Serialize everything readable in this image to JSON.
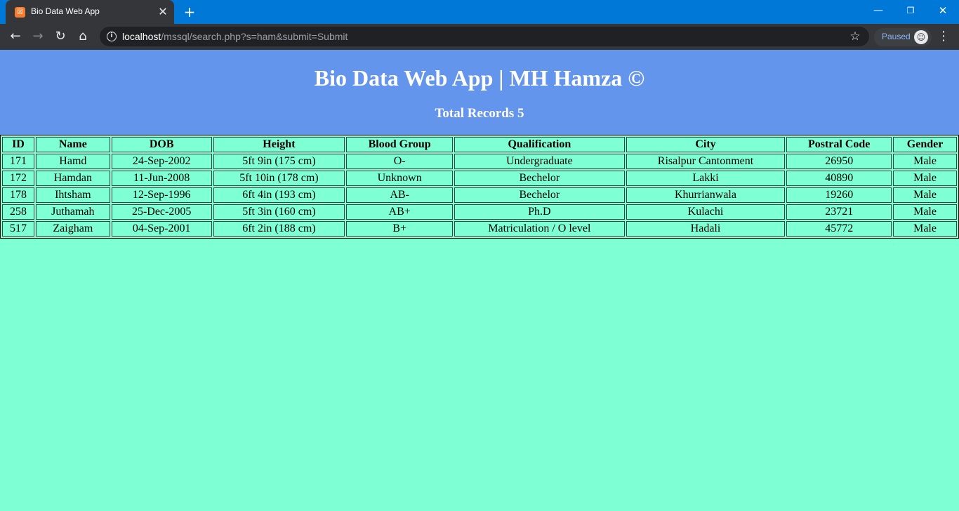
{
  "browser": {
    "tab_title": "Bio Data Web App",
    "tab_favicon": "xampp-icon",
    "url_host": "localhost",
    "url_path": "/mssql/search.php?s=ham&submit=Submit",
    "profile_status": "Paused"
  },
  "page": {
    "title": "Bio Data Web App | MH Hamza ©",
    "record_count": "Total Records 5"
  },
  "table": {
    "columns": [
      "ID",
      "Name",
      "DOB",
      "Height",
      "Blood Group",
      "Qualification",
      "City",
      "Postral Code",
      "Gender"
    ],
    "rows": [
      [
        "171",
        "Hamd",
        "24-Sep-2002",
        "5ft 9in (175 cm)",
        "O-",
        "Undergraduate",
        "Risalpur Cantonment",
        "26950",
        "Male"
      ],
      [
        "172",
        "Hamdan",
        "11-Jun-2008",
        "5ft 10in (178 cm)",
        "Unknown",
        "Bechelor",
        "Lakki",
        "40890",
        "Male"
      ],
      [
        "178",
        "Ihtsham",
        "12-Sep-1996",
        "6ft 4in (193 cm)",
        "AB-",
        "Bechelor",
        "Khurrianwala",
        "19260",
        "Male"
      ],
      [
        "258",
        "Juthamah",
        "25-Dec-2005",
        "5ft 3in (160 cm)",
        "AB+",
        "Ph.D",
        "Kulachi",
        "23721",
        "Male"
      ],
      [
        "517",
        "Zaigham",
        "04-Sep-2001",
        "6ft 2in (188 cm)",
        "B+",
        "Matriculation / O level",
        "Hadali",
        "45772",
        "Male"
      ]
    ]
  },
  "colors": {
    "titlebar": "#0078d7",
    "toolbar": "#35363a",
    "header_bg": "#6495ed",
    "page_bg": "#7fffd4"
  }
}
